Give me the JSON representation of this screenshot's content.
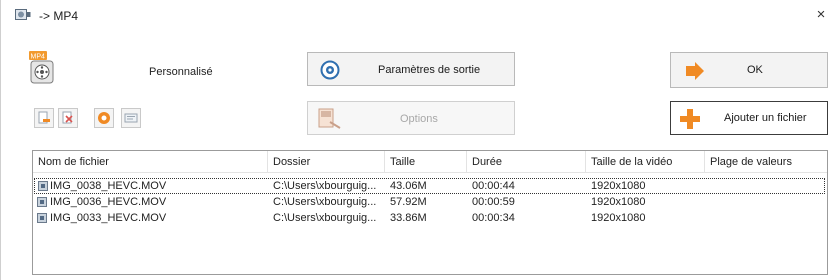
{
  "window": {
    "title": "-> MP4",
    "close_glyph": "×"
  },
  "profile": {
    "label": "Personnalisé",
    "icon": "mp4-film-icon"
  },
  "buttons": {
    "params_label": "Paramètres de sortie",
    "options_label": "Options",
    "ok_label": "OK",
    "add_label": "Ajouter un fichier"
  },
  "toolbar": {
    "icons": [
      "remove-file-icon",
      "clear-list-icon",
      "play-icon",
      "view-icon"
    ]
  },
  "table": {
    "columns": [
      "Nom de fichier",
      "Dossier",
      "Taille",
      "Durée",
      "Taille de la vidéo",
      "Plage de valeurs"
    ],
    "rows": [
      {
        "name": "IMG_0038_HEVC.MOV",
        "folder": "C:\\Users\\xbourguig...",
        "size": "43.06M",
        "duration": "00:00:44",
        "video_size": "1920x1080",
        "range": ""
      },
      {
        "name": "IMG_0036_HEVC.MOV",
        "folder": "C:\\Users\\xbourguig...",
        "size": "57.92M",
        "duration": "00:00:59",
        "video_size": "1920x1080",
        "range": ""
      },
      {
        "name": "IMG_0033_HEVC.MOV",
        "folder": "C:\\Users\\xbourguig...",
        "size": "33.86M",
        "duration": "00:00:34",
        "video_size": "1920x1080",
        "range": ""
      }
    ]
  },
  "colors": {
    "accent_orange": "#f08a24",
    "border": "#b9b9b9",
    "disabled_text": "#a8a8a8"
  }
}
